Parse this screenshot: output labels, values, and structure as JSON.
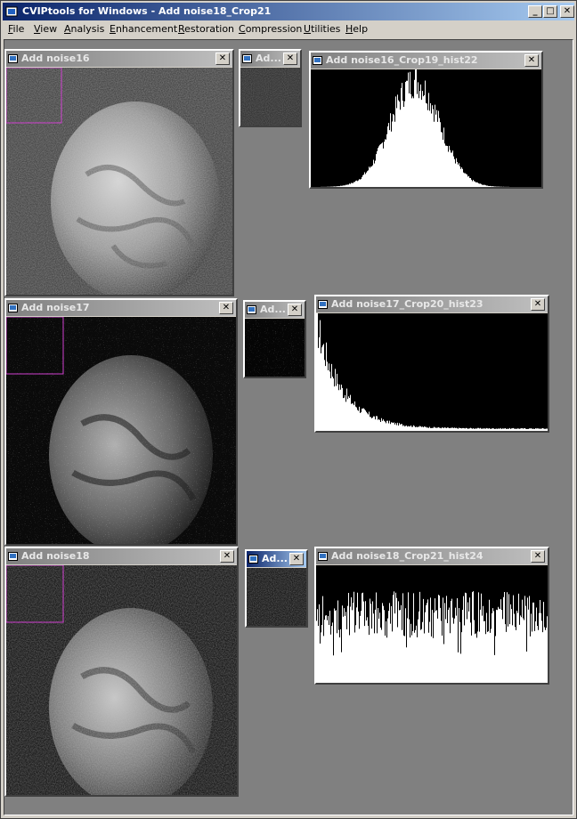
{
  "app": {
    "title": "CVIPtools for Windows - Add noise18_Crop21",
    "menu": [
      "File",
      "View",
      "Analysis",
      "Enhancement",
      "Restoration",
      "Compression",
      "Utilities",
      "Help"
    ],
    "menu_accel": [
      "F",
      "V",
      "A",
      "E",
      "R",
      "C",
      "U",
      "H"
    ],
    "caption_buttons": {
      "minimize": "_",
      "maximize": "□",
      "close": "✕"
    }
  },
  "windows": {
    "noise16": {
      "title": "Add noise16"
    },
    "crop19": {
      "title": "Ad..."
    },
    "hist22": {
      "title": "Add noise16_Crop19_hist22"
    },
    "noise17": {
      "title": "Add noise17"
    },
    "crop20": {
      "title": "Ad..."
    },
    "hist23": {
      "title": "Add noise17_Crop20_hist23"
    },
    "noise18": {
      "title": "Add noise18"
    },
    "crop21": {
      "title": "Ad..."
    },
    "hist24": {
      "title": "Add noise18_Crop21_hist24"
    }
  },
  "close_glyph": "✕",
  "colors": {
    "active_title": "#0a246a",
    "inactive_title": "#808080",
    "mdi_bg": "#808080",
    "roi": "#d040d0"
  }
}
